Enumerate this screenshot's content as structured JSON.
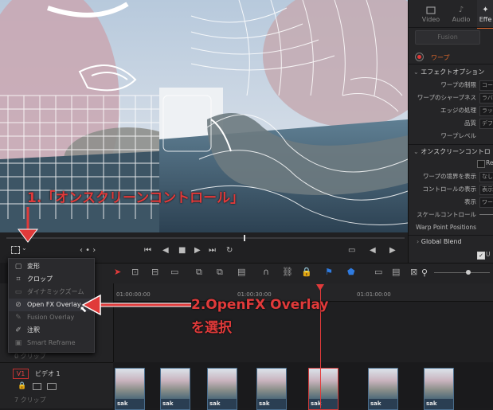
{
  "annotations": {
    "step1": "1.「オンスクリーンコントロール」",
    "step2_line1": "2.OpenFX Overlay",
    "step2_line2": "を選択"
  },
  "inspector": {
    "tabs": [
      {
        "label": "Video",
        "icon": "video-icon"
      },
      {
        "label": "Audio",
        "icon": "audio-icon"
      },
      {
        "label": "Effe",
        "icon": "effects-icon",
        "active": true
      }
    ],
    "fusion_label": "Fusion",
    "effect_name": "ワープ",
    "section1": "エフェクトオプション",
    "rows1": [
      {
        "label": "ワープの制限",
        "value": "コー"
      },
      {
        "label": "ワープのシャープネス",
        "value": "ラバ"
      },
      {
        "label": "エッジの処理",
        "value": "ラッ"
      },
      {
        "label": "品質",
        "value": "デフ"
      },
      {
        "label": "ワープレベル",
        "value": ""
      }
    ],
    "section2": "オンスクリーンコントロ",
    "re_label": "Re",
    "rows2": [
      {
        "label": "ワープの境界を表示",
        "value": "なし"
      },
      {
        "label": "コントロールの表示",
        "value": "表示"
      },
      {
        "label": "表示",
        "value": "ワー"
      },
      {
        "label": "スケールコントロール",
        "value": ""
      },
      {
        "label": "Warp Point Positions",
        "value": ""
      }
    ],
    "section3": "Global Blend",
    "u_label": "U"
  },
  "menu": {
    "items": [
      {
        "label": "変形",
        "icon": "transform-icon",
        "enabled": true
      },
      {
        "label": "クロップ",
        "icon": "crop-icon",
        "enabled": true
      },
      {
        "label": "ダイナミックズーム",
        "icon": "dynamic-zoom-icon",
        "enabled": false
      },
      {
        "label": "Open FX Overlay",
        "icon": "openfx-overlay-icon",
        "enabled": true,
        "highlighted": true
      },
      {
        "label": "Fusion Overlay",
        "icon": "fusion-overlay-icon",
        "enabled": false
      },
      {
        "label": "注釈",
        "icon": "annotation-icon",
        "enabled": true
      },
      {
        "label": "Smart Reframe",
        "icon": "smart-reframe-icon",
        "enabled": false
      }
    ]
  },
  "timeline": {
    "timecodes": [
      "01:00:00:00",
      "01:00:30:00",
      "01:01:00:00"
    ],
    "track_label": "V1",
    "track_name": "ビデオ 1",
    "clip_count_top": "0 クリップ",
    "clip_count_bottom": "7 クリップ",
    "clips": [
      "sak",
      "sak",
      "sak",
      "sak",
      "sak",
      "sak",
      "sak"
    ]
  },
  "colors": {
    "accent": "#e26a2c",
    "annotation": "#e03a3a",
    "playhead": "#e23a3a",
    "selection": "#2f7be0"
  }
}
